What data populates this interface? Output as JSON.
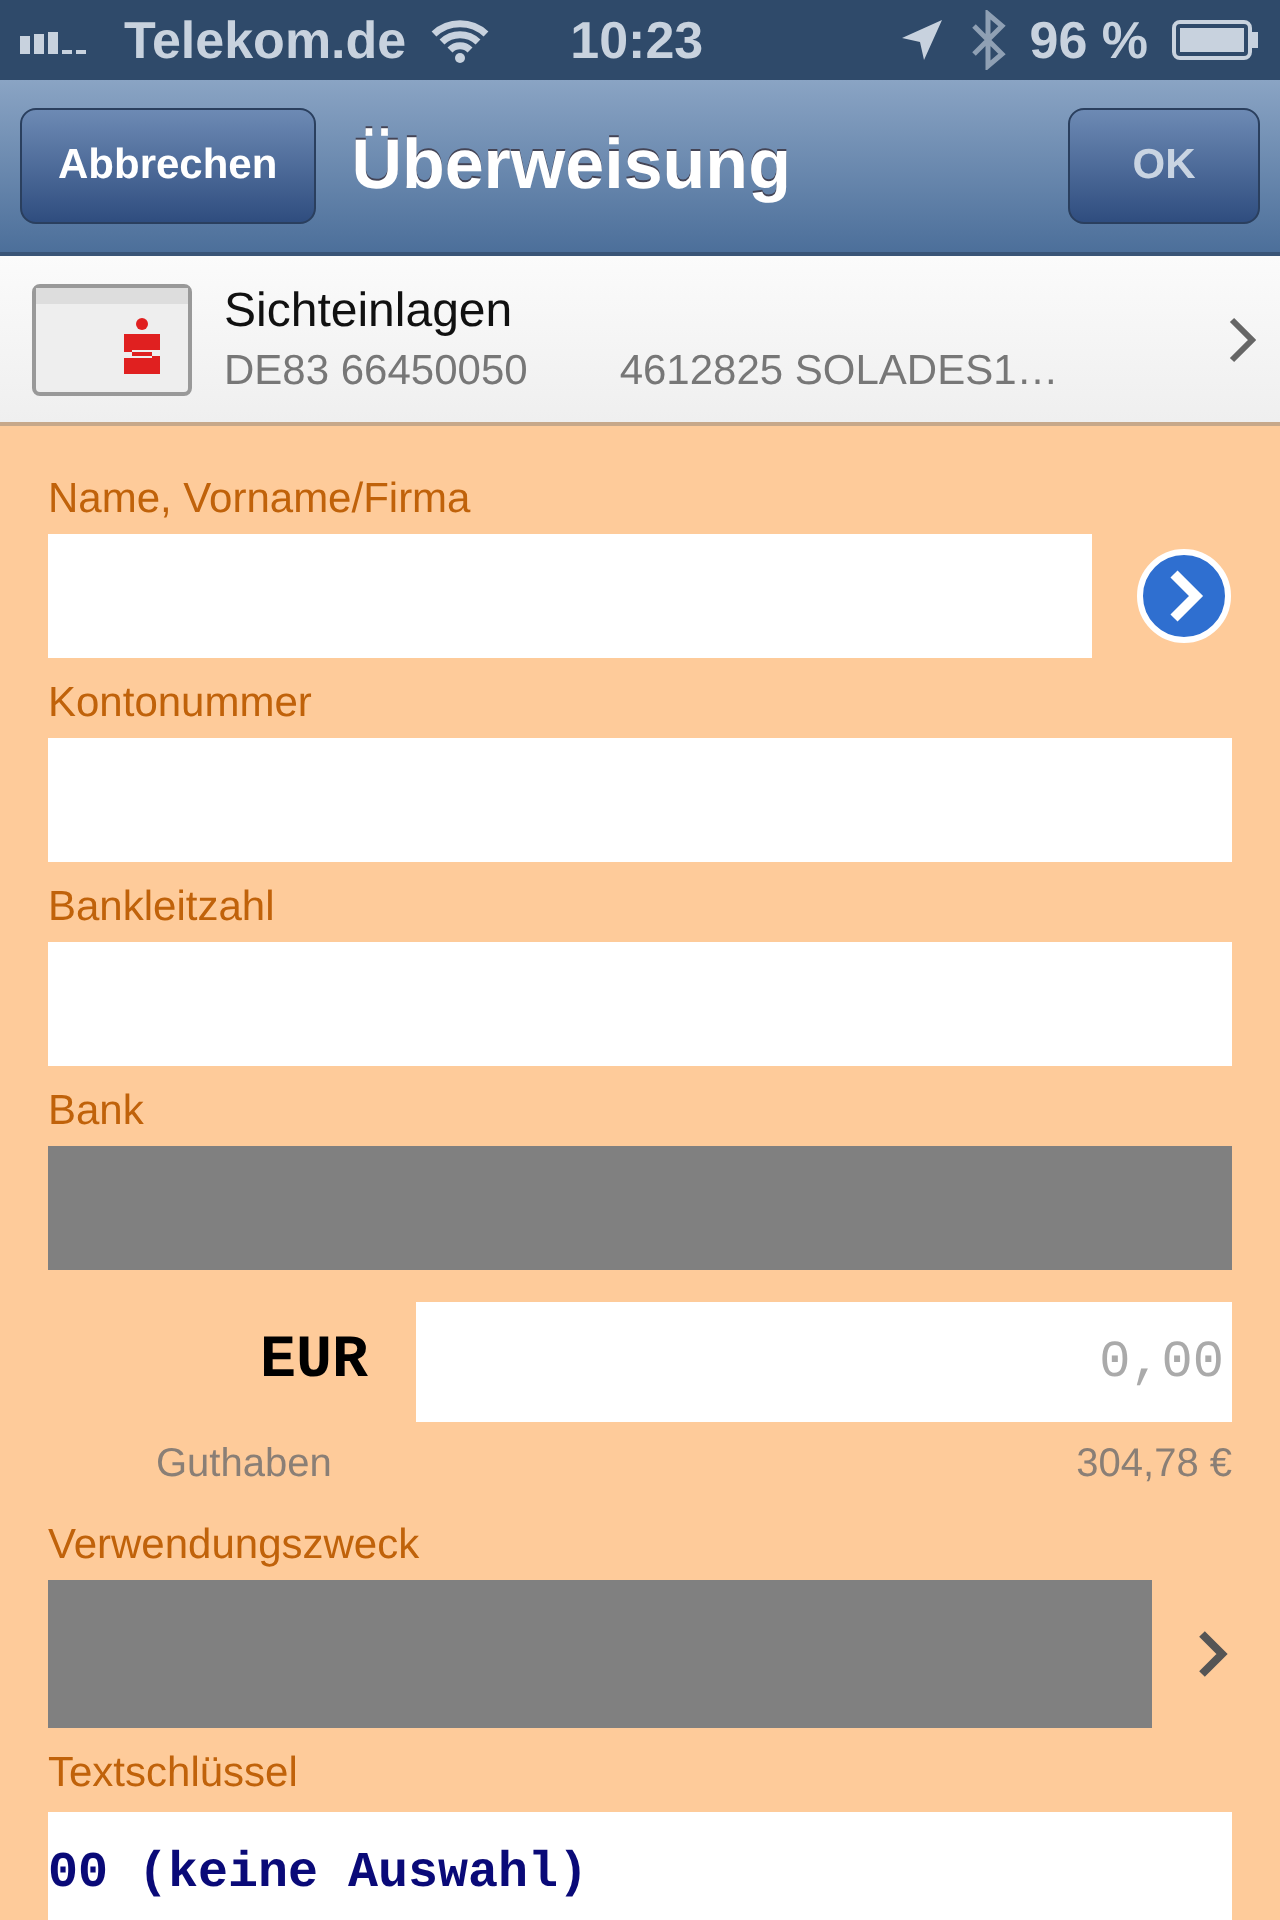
{
  "status_bar": {
    "carrier": "Telekom.de",
    "time": "10:23",
    "battery": "96 %"
  },
  "nav": {
    "cancel": "Abbrechen",
    "title": "Überweisung",
    "ok": "OK"
  },
  "account": {
    "name": "Sichteinlagen",
    "iban": "DE83 66450050",
    "number": "4612825 SOLADES1…"
  },
  "fields": [
    {
      "label": "Name, Vorname/Firma",
      "disabled": false,
      "kind": "contact"
    },
    {
      "label": "Kontonummer",
      "disabled": false,
      "kind": "text"
    },
    {
      "label": "Bankleitzahl",
      "disabled": false,
      "kind": "text"
    },
    {
      "label": "Bank",
      "disabled": true,
      "kind": "text"
    }
  ],
  "amount": {
    "currency": "EUR",
    "placeholder": "0,00",
    "balance_label": "Guthaben",
    "balance": "304,78 €"
  },
  "purpose": {
    "label": "Verwendungszweck",
    "disabled": true
  },
  "text_key": {
    "label": "Textschlüssel",
    "value": "00 (keine Auswahl)"
  }
}
